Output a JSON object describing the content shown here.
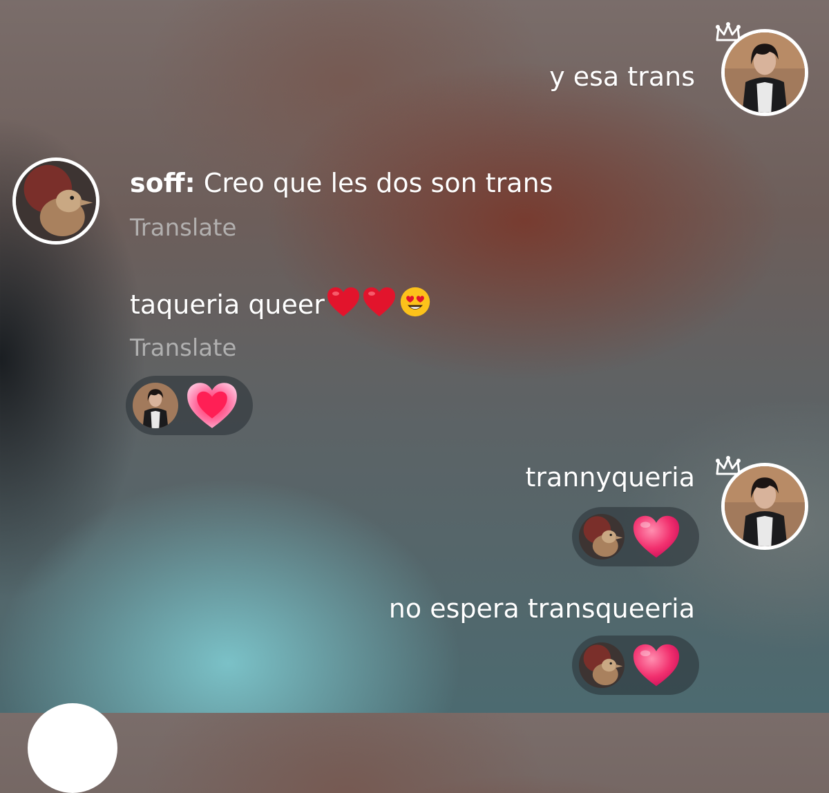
{
  "messages": [
    {
      "text": "y esa trans"
    },
    {
      "author": "soff:",
      "text": "Creo que les dos son trans",
      "translate": "Translate"
    },
    {
      "text": "taqueria queer",
      "translate": "Translate"
    },
    {
      "text": "trannyqueria"
    },
    {
      "text": "no espera transqueeria"
    }
  ],
  "icons": {
    "crown": "crown-icon",
    "heart": "heart-icon",
    "glowing_heart": "glowing-heart-icon",
    "red_heart_emoji": "red-heart-emoji",
    "heart_eyes_emoji": "smiling-face-with-heart-eyes-emoji"
  },
  "colors": {
    "text": "#ffffff",
    "translate": "#bebebe",
    "heart": "#f0306e",
    "reaction_pill": "#283034"
  }
}
